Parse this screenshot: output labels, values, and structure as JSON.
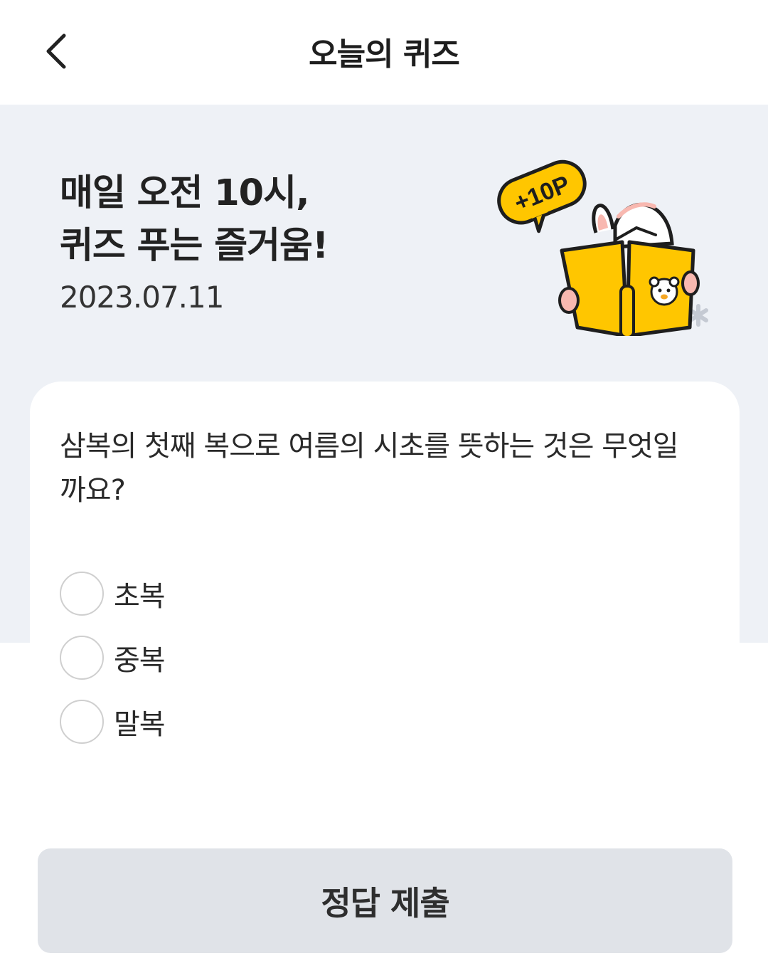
{
  "header": {
    "title": "오늘의 퀴즈",
    "back_icon": "chevron-left-icon"
  },
  "hero": {
    "title_line1": "매일 오전 10시,",
    "title_line2": "퀴즈 푸는 즐거움!",
    "date": "2023.07.11",
    "badge": "+10P",
    "accent_color": "#ffc600"
  },
  "quiz": {
    "question": "삼복의 첫째 복으로 여름의 시초를 뜻하는 것은 무엇일까요?",
    "options": [
      {
        "label": "초복",
        "selected": false
      },
      {
        "label": "중복",
        "selected": false
      },
      {
        "label": "말복",
        "selected": false
      }
    ]
  },
  "submit": {
    "label": "정답 제출",
    "enabled": false
  }
}
